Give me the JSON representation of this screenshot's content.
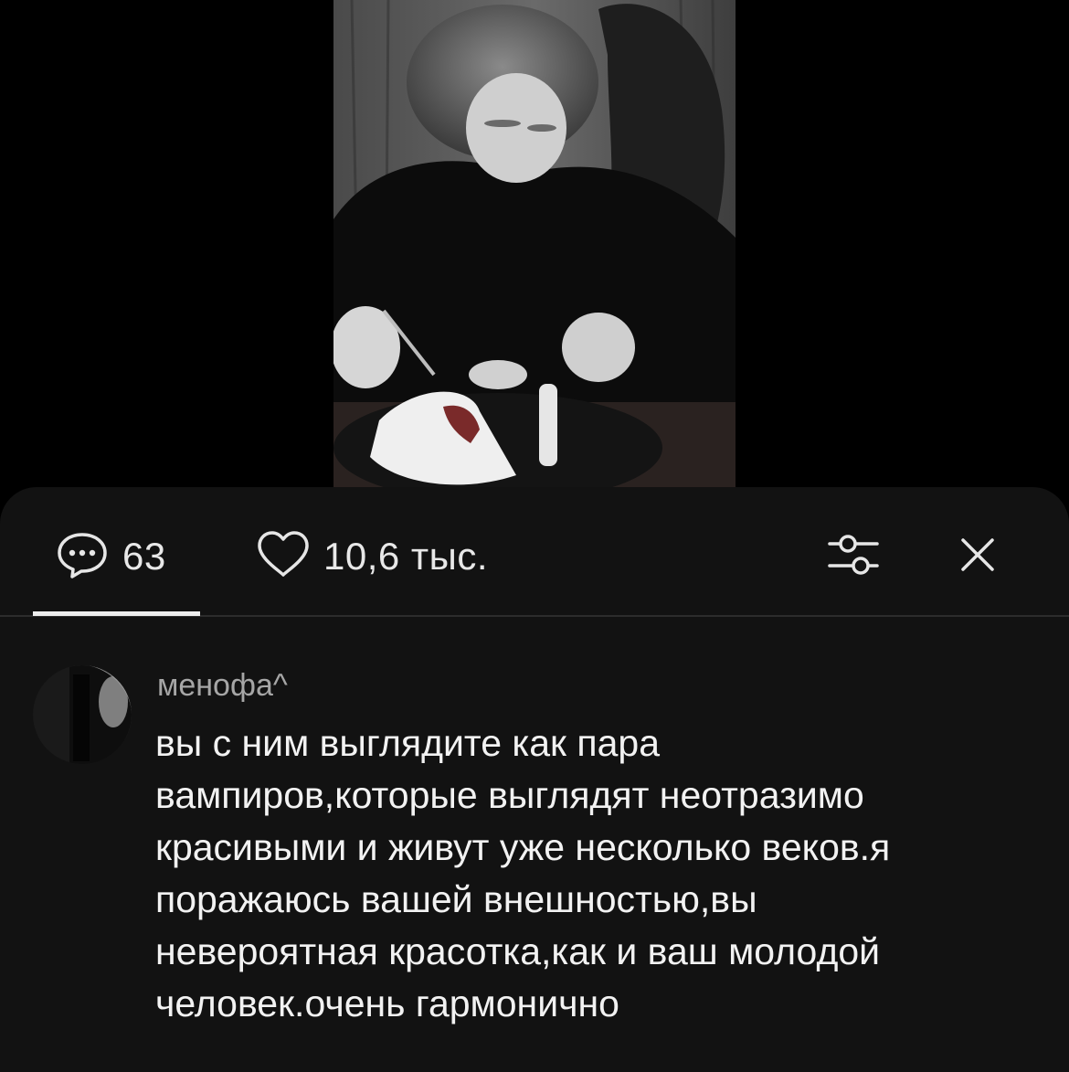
{
  "video": {
    "description_icon": "video-photo"
  },
  "tabs": {
    "comments": {
      "icon": "comment-bubble-icon",
      "count": "63"
    },
    "likes": {
      "icon": "heart-icon",
      "count": "10,6 тыс."
    }
  },
  "actions": {
    "filter_icon": "filter-sliders-icon",
    "close_icon": "close-icon"
  },
  "comment": {
    "author": "менофа^",
    "text": "вы с ним выглядите как пара\nвампиров,которые выглядят неотразимо\nкрасивыми и живут уже несколько веков.я\nпоражаюсь вашей внешностью,вы\nневероятная красотка,как и ваш молодой\nчеловек.очень гармонично"
  },
  "colors": {
    "background": "#000000",
    "sheet": "#121212",
    "text_primary": "#f2f2f2",
    "text_secondary": "#a6a6a6",
    "divider": "#2c2c2c"
  }
}
